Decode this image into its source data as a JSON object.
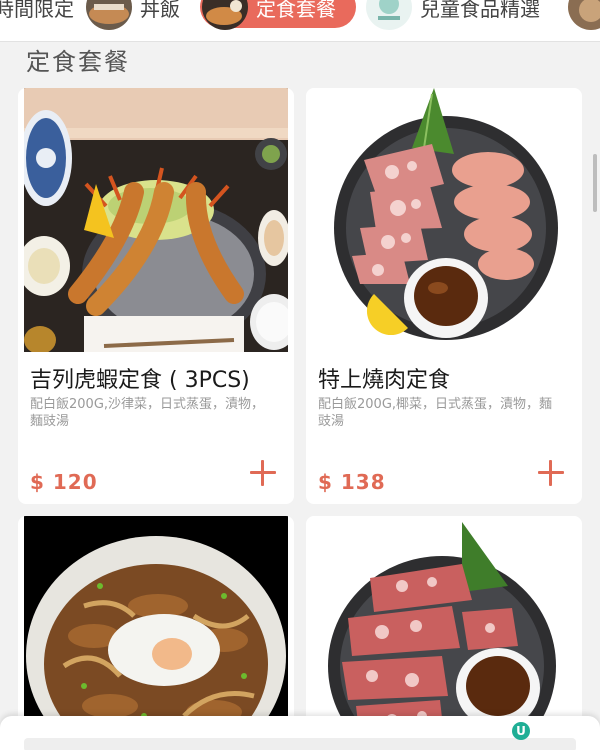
{
  "tabs": [
    {
      "label": "時間限定",
      "active": false
    },
    {
      "label": "丼飯",
      "active": false
    },
    {
      "label": "定食套餐",
      "active": true
    },
    {
      "label": "兒童食品精選",
      "active": false
    }
  ],
  "section_title": "定食套餐",
  "products": [
    {
      "name": "吉列虎蝦定食 ( 3PCS)",
      "description": "配白飯200G,沙律菜，日式蒸蛋，漬物，麵豉湯",
      "price": "$ 120"
    },
    {
      "name": "特上燒肉定食",
      "description": "配白飯200G,椰菜，日式蒸蛋，漬物，麵豉湯",
      "price": "$ 138"
    }
  ],
  "colors": {
    "accent": "#e96a5c",
    "price": "#e06a55"
  },
  "icons": {
    "add": "plus-icon",
    "watermark": "u-logo-icon"
  },
  "watermark_text": "U"
}
